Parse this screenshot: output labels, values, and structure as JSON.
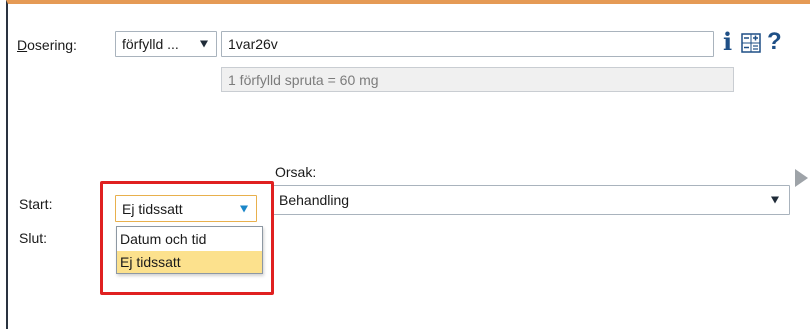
{
  "dosering": {
    "label": "Dosering:",
    "form_select": "förfylld ...",
    "dose_value": "1var26v",
    "conversion_note": "1 förfylld spruta = 60 mg"
  },
  "orsak": {
    "label": "Orsak:",
    "value": "Behandling"
  },
  "start": {
    "label": "Start:",
    "value": "Ej tidssatt",
    "options": [
      "Datum och tid",
      "Ej tidssatt"
    ],
    "selected_index": 1
  },
  "slut": {
    "label": "Slut:"
  },
  "icons": {
    "info": "info-icon",
    "calculator": "calculator-icon",
    "help": "help-icon",
    "expand": "expand-arrow-icon"
  },
  "colors": {
    "top_border": "#e59a55",
    "highlight": "#e02020",
    "selected_option": "#fce18d",
    "dropdown_arrow": "#1a86c8",
    "icon_blue": "#1e4f86"
  }
}
